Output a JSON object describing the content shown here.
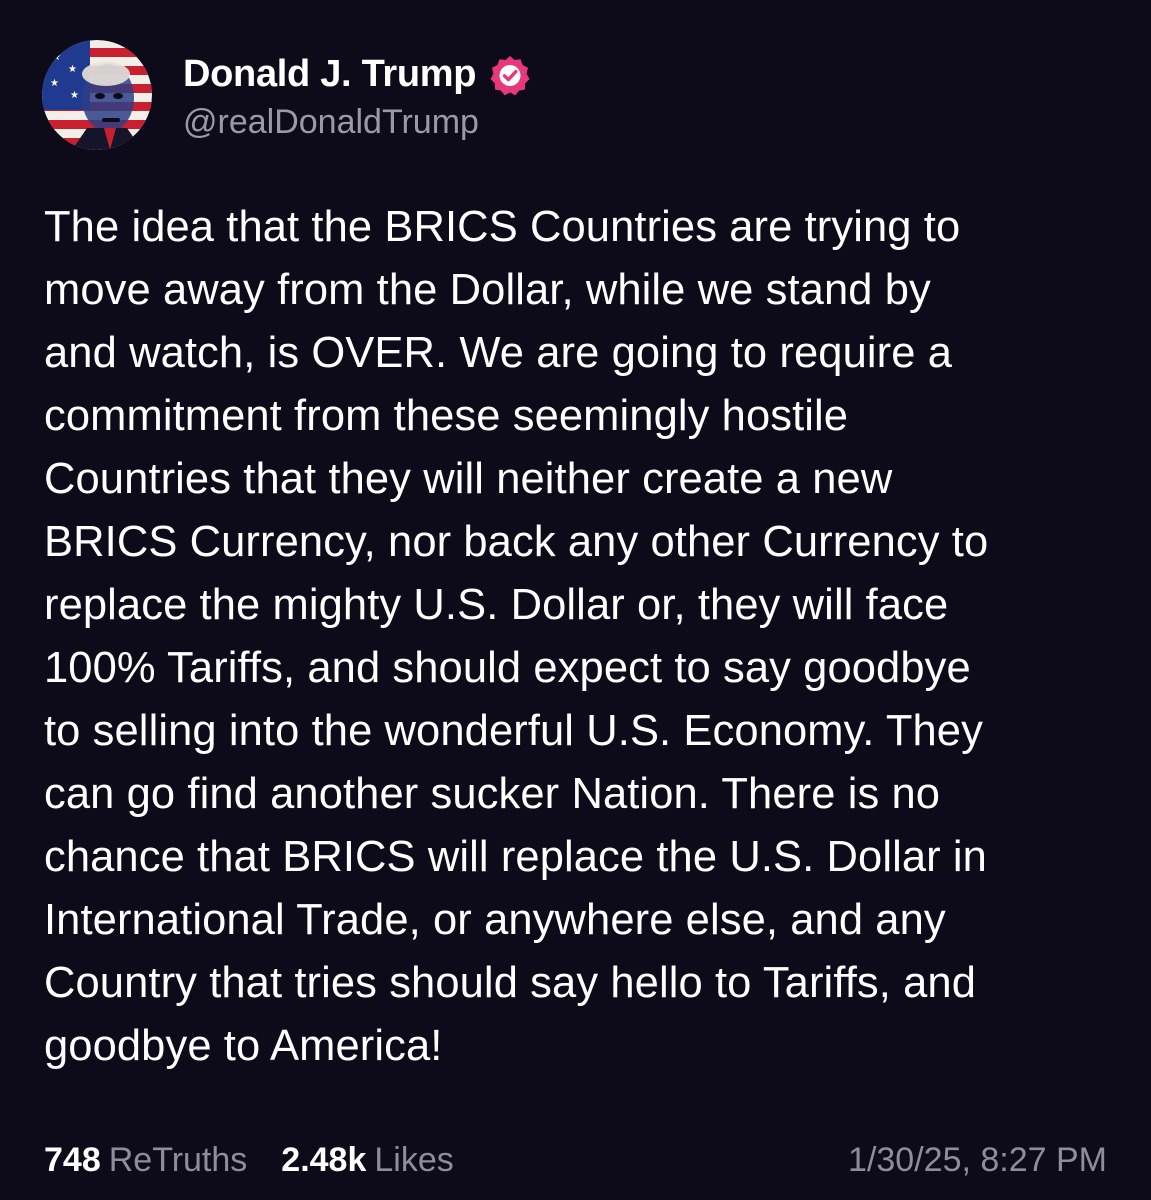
{
  "post": {
    "author": {
      "display_name": "Donald J. Trump",
      "handle": "@realDonaldTrump",
      "verified": true,
      "avatar_icon": "avatar-portrait-american-flag",
      "verified_icon": "verified-badge-icon",
      "verified_color": "#e8377b"
    },
    "text": "The idea that the BRICS Countries are trying to\nmove away from the Dollar, while we stand by\nand watch, is OVER. We are going to require a\ncommitment from these seemingly hostile\nCountries that they will neither create a new\nBRICS Currency, nor back any other Currency to\nreplace the mighty U.S. Dollar or, they will face\n100% Tariffs, and should expect to say goodbye\nto selling into the wonderful U.S. Economy. They\ncan go find another sucker Nation. There is no\nchance that BRICS will replace the U.S. Dollar in\nInternational Trade, or anywhere else, and any\nCountry that tries should say hello to Tariffs, and\ngoodbye to America!",
    "stats": {
      "retruths_count": "748",
      "retruths_label": "ReTruths",
      "likes_count": "2.48k",
      "likes_label": "Likes"
    },
    "timestamp": "1/30/25, 8:27 PM"
  },
  "colors": {
    "background": "#0d0a1a",
    "text": "#ffffff",
    "muted": "#8f8c9c"
  }
}
